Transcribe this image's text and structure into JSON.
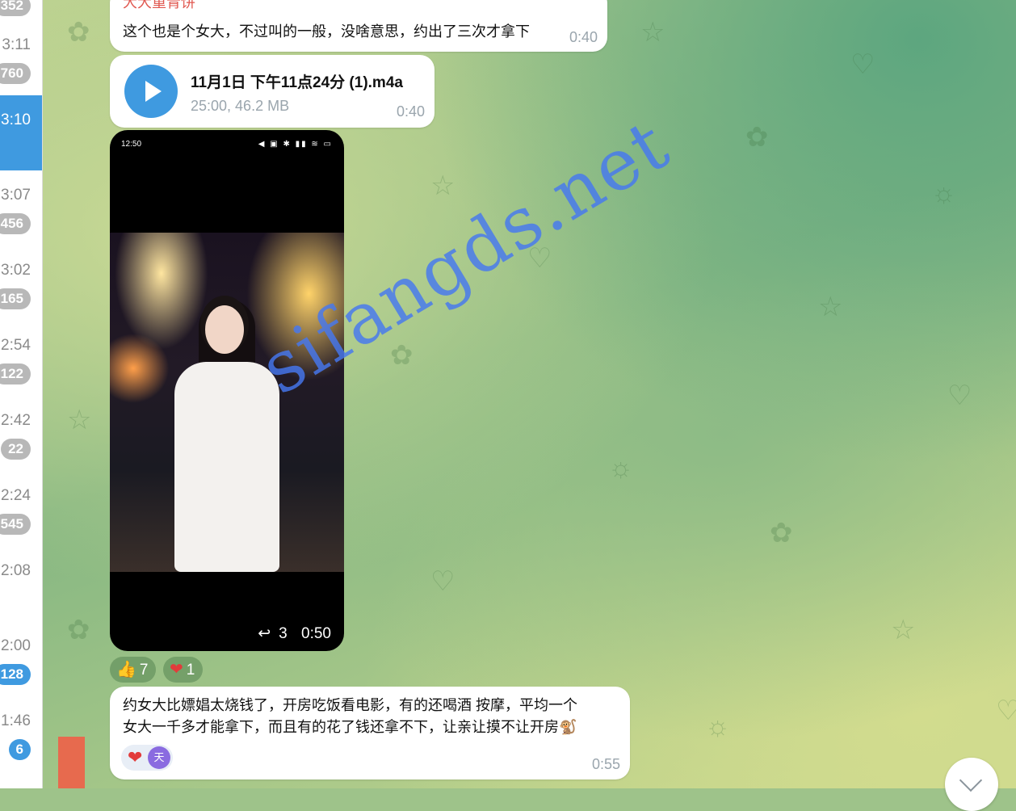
{
  "chat_list": [
    {
      "time": "",
      "count": "352",
      "active": false
    },
    {
      "time": "3:11",
      "count": "760",
      "active": false
    },
    {
      "time": "3:10",
      "count": "",
      "active": true
    },
    {
      "time": "3:07",
      "count": "456",
      "active": false
    },
    {
      "time": "3:02",
      "count": "165",
      "active": false
    },
    {
      "time": "2:54",
      "count": "122",
      "active": false
    },
    {
      "time": "2:42",
      "count": "22",
      "active": false
    },
    {
      "time": "2:24",
      "count": "545",
      "active": false
    },
    {
      "time": "2:08",
      "count": "",
      "active": false
    },
    {
      "time": "2:00",
      "count": "128",
      "active": false
    },
    {
      "time": "1:46",
      "count": "6",
      "active": false
    }
  ],
  "messages": {
    "m1": {
      "sender": "大大重青饼",
      "text": "这个也是个女大，不过叫的一般，没啥意思，约出了三次才拿下",
      "time": "0:40"
    },
    "m2": {
      "file_name": "11月1日 下午11点24分 (1).m4a",
      "meta": "25:00, 46.2 MB",
      "time": "0:40"
    },
    "m3": {
      "status_time": "12:50",
      "status_icons": "◀ ▣ ✱ ▮▮ ≋ ▭",
      "forwards": "3",
      "duration": "0:50",
      "reactions": [
        {
          "emoji": "👍",
          "count": "7"
        },
        {
          "emoji": "❤",
          "count": "1"
        }
      ]
    },
    "m4": {
      "line1": "约女大比嫖娼太烧钱了，开房吃饭看电影，有的还喝酒 按摩，平均一个",
      "line2": "女大一千多才能拿下，而且有的花了钱还拿不下，让亲让摸不让开房🐒",
      "time": "0:55",
      "reaction_heart": "❤",
      "reaction_avatar": "天"
    }
  },
  "watermark": "sifangds.net"
}
